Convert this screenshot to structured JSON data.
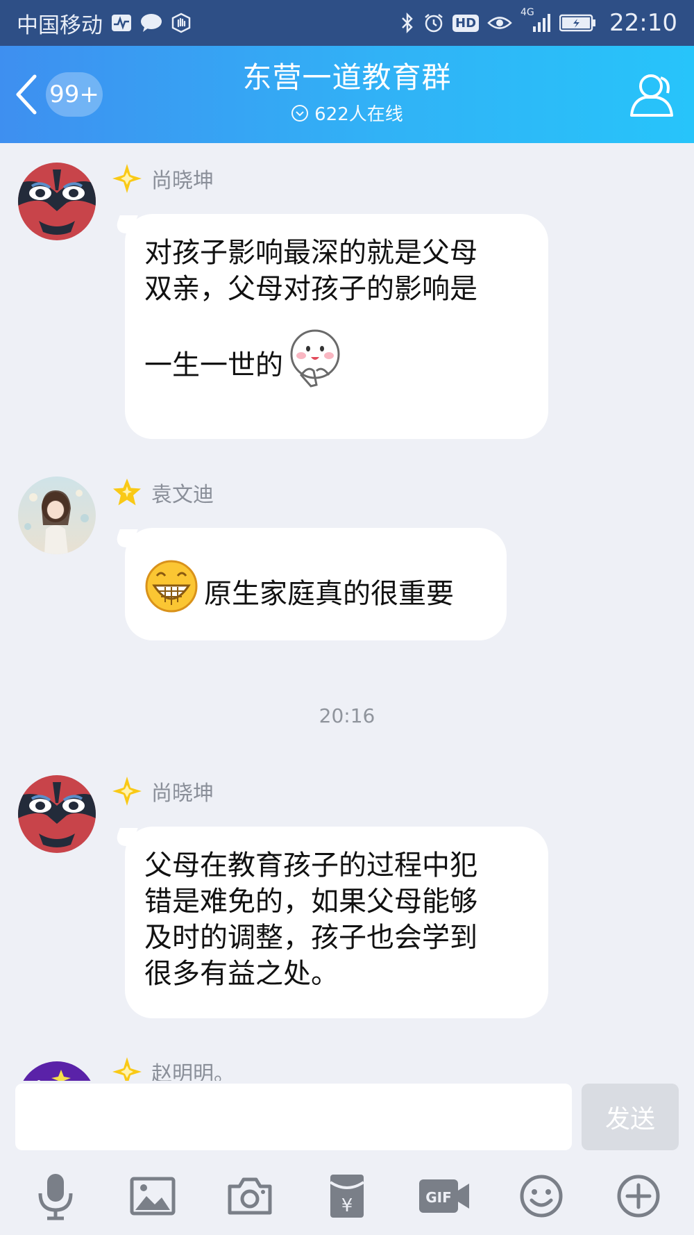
{
  "status_bar": {
    "carrier": "中国移动",
    "network": "4G",
    "hd_label": "HD",
    "time": "22:10"
  },
  "header": {
    "badge": "99+",
    "title": "东营一道教育群",
    "online": "622人在线"
  },
  "messages": [
    {
      "sender": "尚晓坤",
      "lines": [
        "对孩子影响最深的就是父母",
        "双亲，父母对孩子的影响是",
        "一生一世的"
      ]
    },
    {
      "sender": "袁文迪",
      "text": "原生家庭真的很重要"
    },
    {
      "sender": "尚晓坤",
      "lines": [
        "父母在教育孩子的过程中犯",
        "错是难免的，如果父母能够",
        "及时的调整，孩子也会学到",
        "很多有益之处。"
      ]
    },
    {
      "sender": "赵明明。"
    }
  ],
  "timestamp": "20:16",
  "input": {
    "value": "",
    "send_label": "发送"
  },
  "toolbar": [
    "microphone-icon",
    "image-icon",
    "camera-icon",
    "red-packet-icon",
    "gif-icon",
    "emoji-icon",
    "plus-icon"
  ],
  "colors": {
    "status_bar": "#2E4F86",
    "header_start": "#3E8FF0",
    "header_end": "#27C4FA",
    "background": "#EEF0F6",
    "send_disabled": "#D9DCE2"
  }
}
